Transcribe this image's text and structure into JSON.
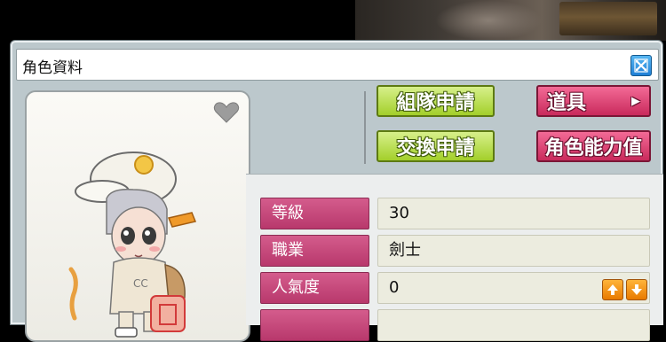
{
  "window": {
    "title": "角色資料"
  },
  "buttons": {
    "party_request": "組隊申請",
    "trade_request": "交換申請",
    "items": "道具",
    "character_stats": "角色能力值"
  },
  "stats": [
    {
      "label": "等級",
      "value": "30"
    },
    {
      "label": "職業",
      "value": "劍士"
    },
    {
      "label": "人氣度",
      "value": "0"
    }
  ],
  "colors": {
    "green_button": "#a3cf2a",
    "pink_button": "#c92a5c",
    "stat_label": "#c44a7c",
    "close_button": "#1f7fd6"
  },
  "icons": {
    "close": "close-icon",
    "heart": "heart-icon",
    "fame_up": "arrow-up-icon",
    "fame_down": "arrow-down-icon",
    "submenu": "triangle-right-icon"
  }
}
